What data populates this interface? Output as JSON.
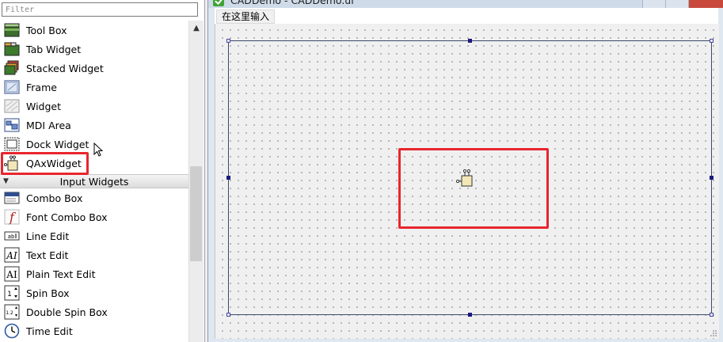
{
  "widget_box": {
    "filter_placeholder": "Filter",
    "items_top": [
      {
        "label": "Tool Box",
        "icon": "toolbox-icon"
      },
      {
        "label": "Tab Widget",
        "icon": "tab-widget-icon"
      },
      {
        "label": "Stacked Widget",
        "icon": "stacked-widget-icon"
      },
      {
        "label": "Frame",
        "icon": "frame-icon"
      },
      {
        "label": "Widget",
        "icon": "widget-icon"
      },
      {
        "label": "MDI Area",
        "icon": "mdi-area-icon"
      },
      {
        "label": "Dock Widget",
        "icon": "dock-widget-icon"
      },
      {
        "label": "QAxWidget",
        "icon": "qaxwidget-icon"
      }
    ],
    "category": "Input Widgets",
    "items_input": [
      {
        "label": "Combo Box",
        "icon": "combo-box-icon"
      },
      {
        "label": "Font Combo Box",
        "icon": "font-combo-box-icon"
      },
      {
        "label": "Line Edit",
        "icon": "line-edit-icon"
      },
      {
        "label": "Text Edit",
        "icon": "text-edit-icon"
      },
      {
        "label": "Plain Text Edit",
        "icon": "plain-text-edit-icon"
      },
      {
        "label": "Spin Box",
        "icon": "spin-box-icon"
      },
      {
        "label": "Double Spin Box",
        "icon": "double-spin-box-icon"
      },
      {
        "label": "Time Edit",
        "icon": "time-edit-icon"
      }
    ]
  },
  "designer": {
    "window_title": "CADDemo - CADDemo.ui",
    "menu_placeholder": "在这里输入"
  },
  "colors": {
    "highlight": "#e8262d",
    "selection_handle": "#1a1a80",
    "app_icon": "#41a336"
  }
}
